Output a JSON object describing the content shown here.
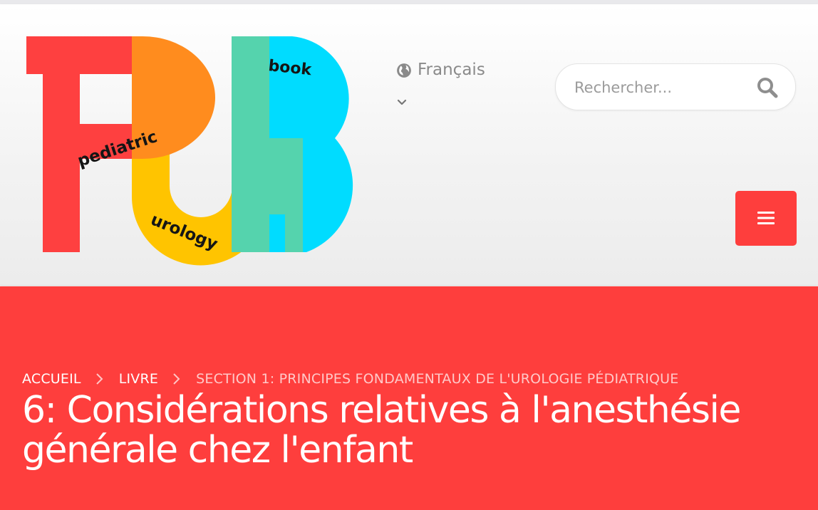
{
  "header": {
    "logo": {
      "letters": "PUB",
      "words": [
        "pediatric",
        "urology",
        "book"
      ]
    },
    "language": {
      "label": "Français",
      "icon": "globe-icon",
      "chevron_icon": "chevron-down-icon"
    },
    "search": {
      "placeholder": "Rechercher...",
      "value": "",
      "icon": "search-icon"
    },
    "menu_button": {
      "icon": "hamburger-menu-icon"
    }
  },
  "hero": {
    "breadcrumb": [
      {
        "label": "ACCUEIL"
      },
      {
        "label": "LIVRE"
      },
      {
        "label": "SECTION 1: PRINCIPES FONDAMENTAUX DE L'UROLOGIE PÉDIATRIQUE"
      }
    ],
    "title": "6: Considérations relatives à l'anesthésie générale chez l'enfant"
  },
  "colors": {
    "brand_red": "#fe3e3d",
    "logo_orange": "#ff8c1e",
    "logo_yellow": "#ffc400",
    "logo_green": "#55d3ad",
    "logo_cyan": "#00dcff"
  }
}
